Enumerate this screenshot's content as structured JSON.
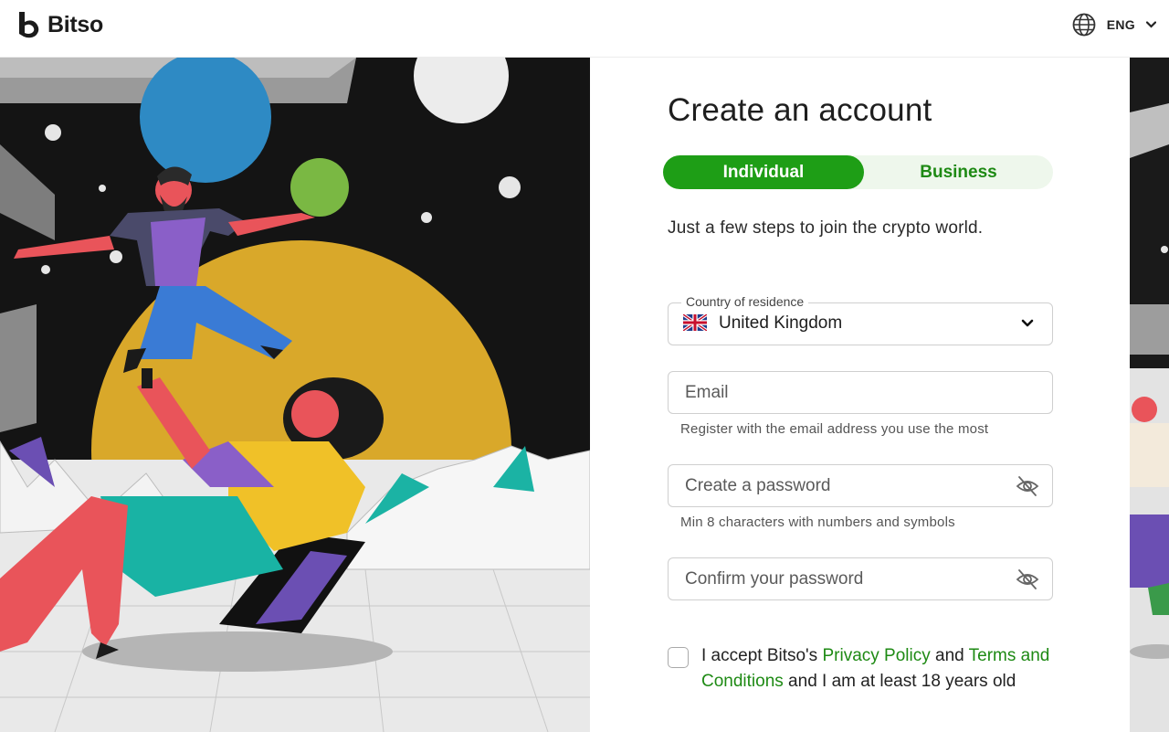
{
  "header": {
    "brand": "Bitso",
    "language": "ENG",
    "icons": {
      "logo": "bitso-logo-icon",
      "language": "globe-icon",
      "language_chevron": "chevron-down-icon"
    }
  },
  "form": {
    "title": "Create an account",
    "account_type": {
      "individual_label": "Individual",
      "business_label": "Business",
      "selected": "Individual"
    },
    "subtitle": "Just a few steps to join the crypto world.",
    "country": {
      "label": "Country of residence",
      "value": "United Kingdom",
      "flag_icon": "uk-flag-icon"
    },
    "email": {
      "placeholder": "Email",
      "hint": "Register with the email address you use the most"
    },
    "password": {
      "placeholder": "Create a password",
      "hint": "Min 8 characters with numbers and symbols",
      "icon": "eye-off-icon"
    },
    "confirm_password": {
      "placeholder": "Confirm your password",
      "icon": "eye-off-icon"
    },
    "terms": {
      "prefix": "I accept Bitso's ",
      "privacy_link": "Privacy Policy",
      "middle": " and ",
      "terms_link": "Terms and Conditions",
      "suffix": " and I am at least 18 years old"
    }
  },
  "colors": {
    "accent_green": "#1e9e16",
    "link_green": "#1e8a14",
    "toggle_bg": "#eef7ec",
    "illustration_sky": "#141414",
    "illustration_sun": "#d9a82a"
  }
}
